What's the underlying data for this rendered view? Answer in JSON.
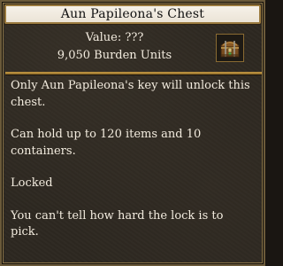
{
  "window": {
    "title": "Aun Papileona's Chest"
  },
  "item": {
    "value_text": "Value: ???",
    "burden_text": "9,050 Burden Units",
    "icon": "chest-icon"
  },
  "description": {
    "line1": "Only Aun Papileona's key will unlock this chest.",
    "line2": "Can hold up to 120 items and 10 containers.",
    "line3": "Locked",
    "line4": "You can't tell how hard the lock is to pick."
  }
}
